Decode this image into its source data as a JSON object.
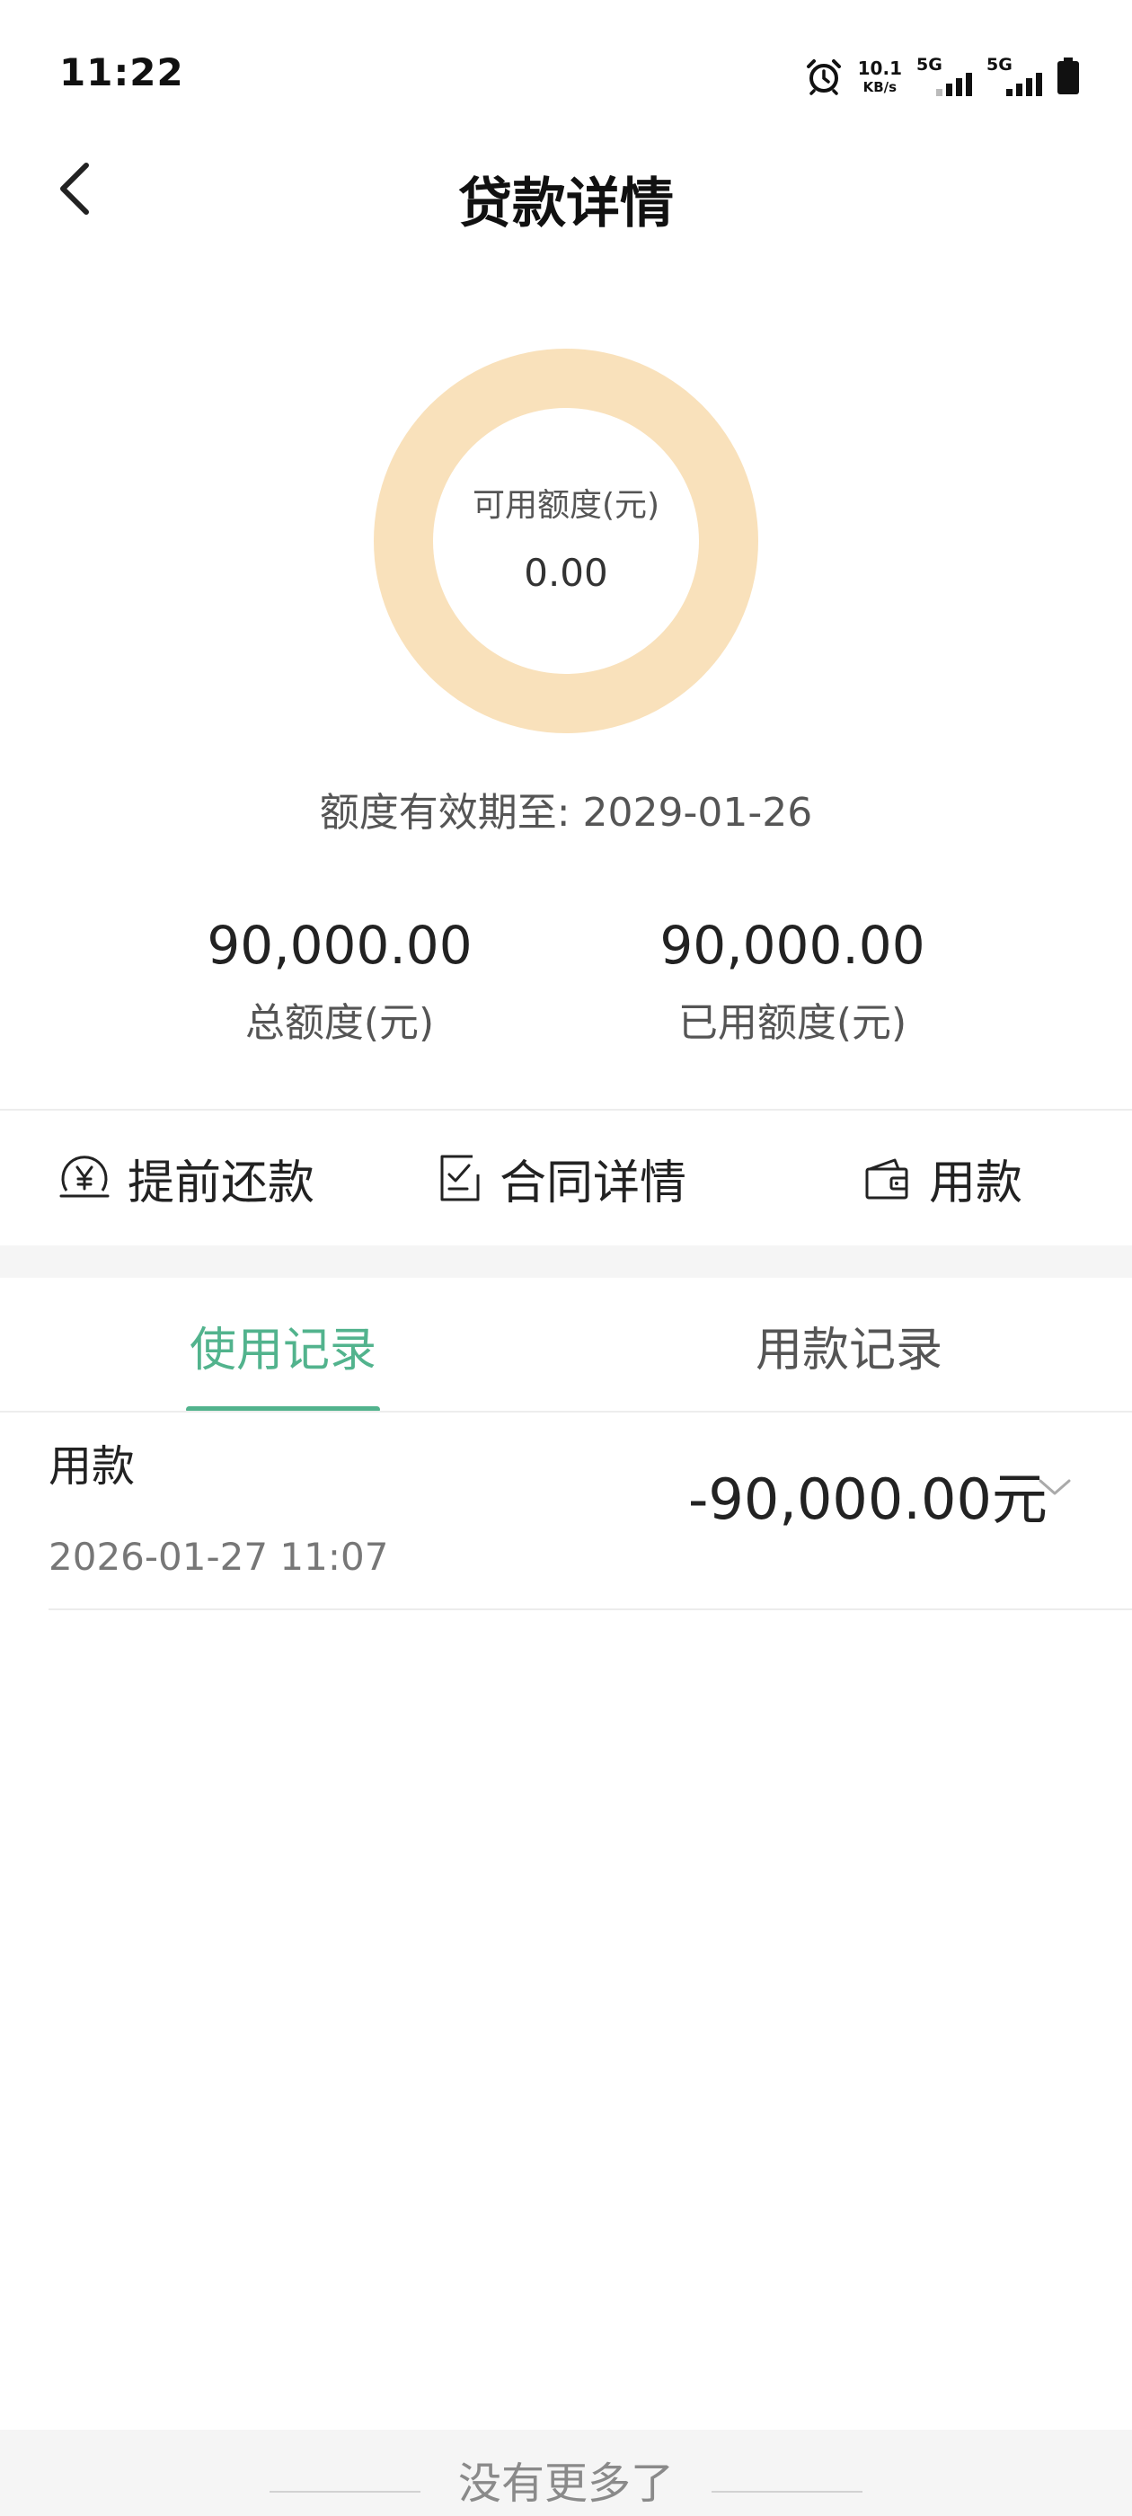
{
  "status_bar": {
    "time": "11:22",
    "net_speed": "10.1",
    "net_speed_unit": "KB/s",
    "signal1_label": "5G",
    "signal2_label": "5G"
  },
  "header": {
    "title": "贷款详情"
  },
  "credit_donut": {
    "label": "可用额度(元)",
    "value": "0.00",
    "ring_color": "#f9e1bb"
  },
  "validity": {
    "label": "额度有效期至:",
    "date": "2029-01-26"
  },
  "stats": {
    "total_value": "90,000.00",
    "total_label": "总额度(元)",
    "used_value": "90,000.00",
    "used_label": "已用额度(元)"
  },
  "actions": {
    "prepay": "提前还款",
    "contract": "合同详情",
    "borrow": "用款"
  },
  "tabs": [
    {
      "label": "使用记录",
      "active": true
    },
    {
      "label": "用款记录",
      "active": false
    }
  ],
  "records": [
    {
      "title": "用款",
      "time": "2026-01-27 11:07",
      "amount": "-90,000.00元"
    }
  ],
  "footer": {
    "text": "没有更多了"
  },
  "colors": {
    "accent": "#52b38d",
    "ring": "#f9e1bb"
  },
  "icons": {
    "back": "chevron-left-icon",
    "prepay": "yen-coin-icon",
    "contract": "document-check-icon",
    "borrow": "wallet-icon",
    "expand": "chevron-down-icon",
    "alarm": "alarm-icon",
    "battery": "battery-icon"
  }
}
